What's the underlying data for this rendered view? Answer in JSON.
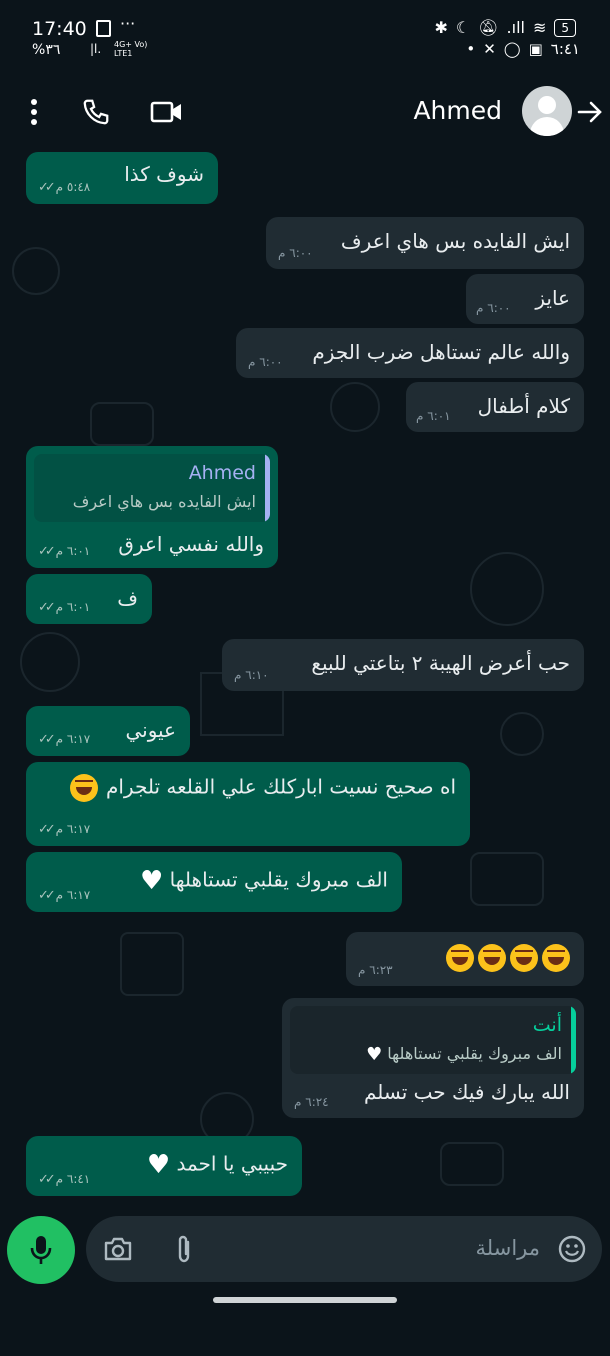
{
  "status": {
    "time": "17:40",
    "left_sub": "%٣٦",
    "net1": "4G+ Vo)",
    "net2": "LTE1",
    "battery": "5",
    "right_time": "٦:٤١"
  },
  "header": {
    "contact_name": "Ahmed"
  },
  "messages": [
    {
      "text": "شوف كذا",
      "time": "٥:٤٨ م"
    },
    {
      "text": "ايش الفايده بس هاي اعرف",
      "time": "٦:٠٠ م"
    },
    {
      "text": "عايز",
      "time": "٦:٠٠ م"
    },
    {
      "text": "والله عالم تستاهل ضرب الجزم",
      "time": "٦:٠٠ م"
    },
    {
      "text": "كلام أطفال",
      "time": "٦:٠١ م"
    },
    {
      "quote_name": "Ahmed",
      "quote_text": "ايش الفايده بس هاي اعرف",
      "text": "والله نفسي اعرق",
      "time": "٦:٠١ م"
    },
    {
      "text": "ف",
      "time": "٦:٠١ م"
    },
    {
      "text": "حب أعرض الهيبة ٢ بتاعتي للبيع",
      "time": "٦:١٠ م"
    },
    {
      "text": "عيوني",
      "time": "٦:١٧ م"
    },
    {
      "text": "اه صحيح نسيت اباركلك علي القلعه تلجرام",
      "time": "٦:١٧ م"
    },
    {
      "text": "الف مبروك يقلبي تستاهلها",
      "time": "٦:١٧ م"
    },
    {
      "text": "",
      "time": "٦:٢٣ م"
    },
    {
      "quote_name": "أنت",
      "quote_text": "الف مبروك يقلبي تستاهلها",
      "text": "الله يبارك فيك حب تسلم",
      "time": "٦:٢٤ م"
    },
    {
      "text": "حبيبي يا احمد",
      "time": "٦:٤١ م"
    }
  ],
  "input": {
    "placeholder": "مراسلة"
  },
  "colors": {
    "outgoing": "#005c4b",
    "incoming": "#202c33",
    "background": "#0b141a",
    "accent": "#21c063"
  }
}
